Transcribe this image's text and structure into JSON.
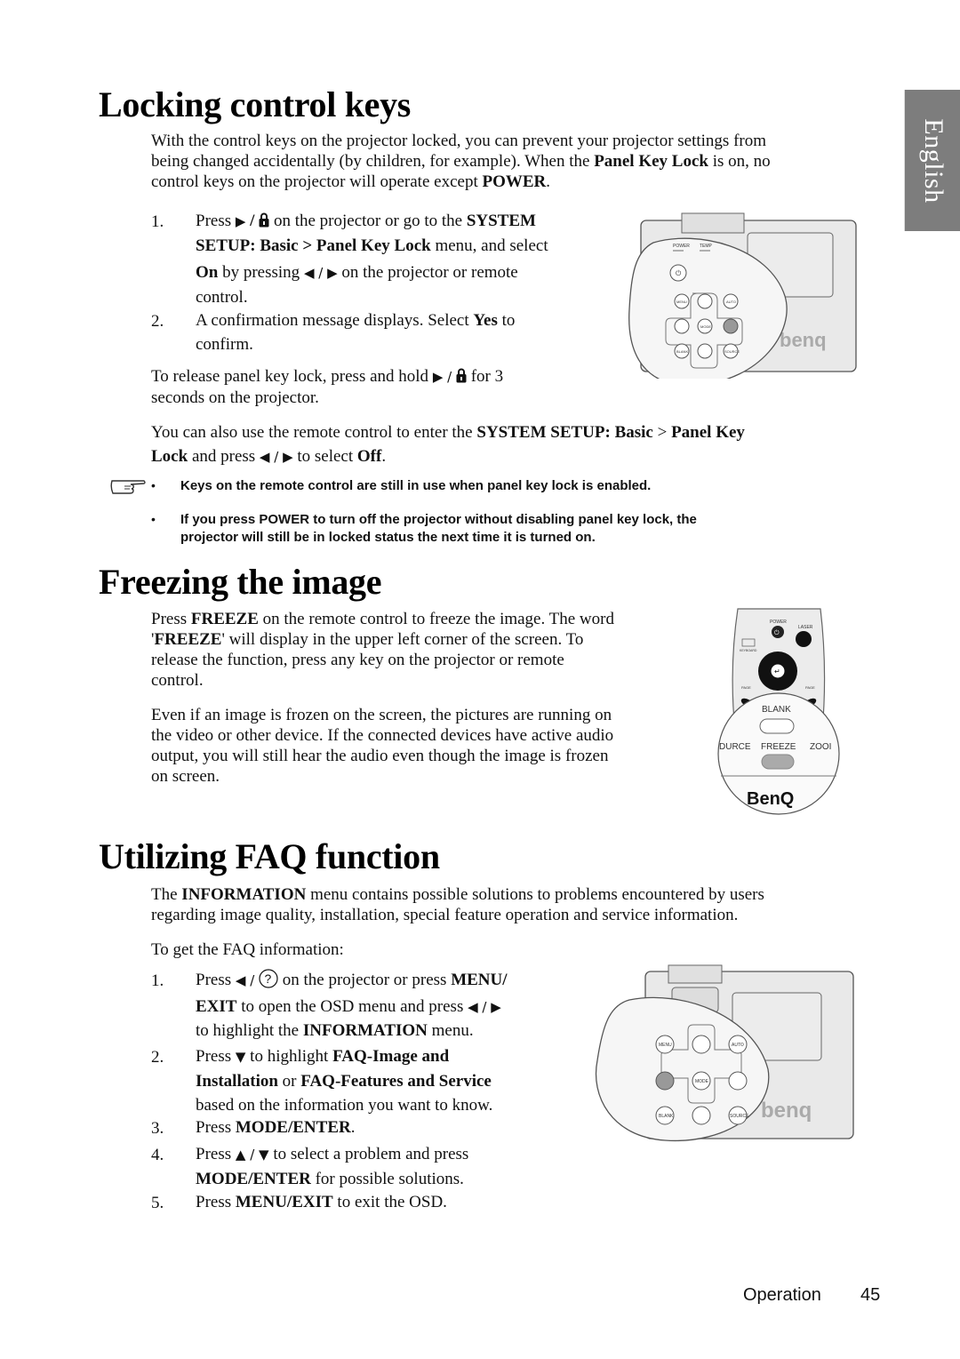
{
  "side_tab": {
    "label": "English"
  },
  "section1": {
    "title": "Locking control keys",
    "intro": {
      "t1": "With the control keys on the projector locked, you can prevent your projector settings from",
      "t2": "being changed accidentally (by children, for example). When the ",
      "b1": "Panel Key Lock",
      "t3": " is on, no",
      "t4": "control keys on the projector will operate except ",
      "b2": "POWER",
      "t5": "."
    },
    "steps": [
      {
        "num": "1.",
        "l1a": "Press ",
        "l1b": " on the projector or go to the ",
        "l1bold": "SYSTEM",
        "l2bold": "SETUP: Basic > Panel Key Lock",
        "l2b": " menu, and select",
        "l3bold": "On",
        "l3a": " by pressing ",
        "l3b": " on the projector or remote",
        "l4": "control."
      },
      {
        "num": "2.",
        "l1a": "A confirmation message displays. Select ",
        "l1bold": "Yes",
        "l1b": " to",
        "l2": "confirm."
      }
    ],
    "release": {
      "t1": "To release panel key lock, press and hold ",
      "t2": " for 3",
      "t3": "seconds on the projector."
    },
    "remote": {
      "t1": "You can also use the remote control to enter the ",
      "b1": "SYSTEM SETUP: Basic",
      "t2": " > ",
      "b2": "Panel Key",
      "b3": "Lock",
      "t3": " and press ",
      "t4": " to select ",
      "b4": "Off",
      "t5": "."
    },
    "notes": [
      "Keys on the remote control are still in use when panel key lock is enabled.",
      "If you press POWER to turn off the projector without disabling panel key lock, the",
      "projector will still be in locked status the next time it is turned on."
    ],
    "figure": {
      "labels": [
        "POWER",
        "TEMP",
        "MENU EXIT",
        "AUTO",
        "MODE ENTER",
        "BLANK",
        "SOURCE"
      ],
      "brand": "benq"
    }
  },
  "section2": {
    "title": "Freezing the image",
    "p1": {
      "t1": "Press ",
      "b1": "FREEZE",
      "t2": " on the remote control to freeze the image. The word",
      "t3": "'",
      "b2": "FREEZE",
      "t4": "' will display in the upper left corner of the screen. To",
      "t5": "release the function, press any key on the projector or remote",
      "t6": "control."
    },
    "p2": [
      "Even if an image is frozen on the screen, the pictures are running on",
      "the video or other device. If the connected devices have active audio",
      "output, you will still hear the audio even though the image is frozen",
      "on screen."
    ],
    "figure": {
      "labels": [
        "POWER",
        "LASER",
        "KEYBOARD FUNCTION",
        "PAGE UP",
        "PAGE DOWN",
        "BLANK",
        "DURCE",
        "FREEZE",
        "ZOOI"
      ],
      "brand": "BenQ"
    }
  },
  "section3": {
    "title": "Utilizing FAQ function",
    "intro": {
      "t1": "The ",
      "b1": "INFORMATION",
      "t2": " menu contains possible solutions to problems encountered by users",
      "t3": "regarding image quality, installation, special feature operation and service information."
    },
    "lead": "To get the FAQ information:",
    "steps": [
      {
        "num": "1.",
        "l1a": "Press ",
        "l1b": " on the projector or press ",
        "l1bold": "MENU/",
        "l2bold": "EXIT",
        "l2a": " to open the OSD menu and press ",
        "l3a": "to highlight the ",
        "l3bold": "INFORMATION",
        "l3b": " menu."
      },
      {
        "num": "2.",
        "l1a": "Press ",
        "l1b": " to highlight ",
        "l1bold": "FAQ-Image and",
        "l2bold1": "Installation",
        "l2a": " or ",
        "l2bold2": "FAQ-Features and Service",
        "l3": "based on the information you want to know."
      },
      {
        "num": "3.",
        "l1a": "Press ",
        "l1bold": "MODE/ENTER",
        "l1b": "."
      },
      {
        "num": "4.",
        "l1a": "Press ",
        "l1b": " to select a problem and press",
        "l2bold": "MODE/ENTER",
        "l2a": " for possible solutions."
      },
      {
        "num": "5.",
        "l1a": "Press ",
        "l1bold": "MENU/EXIT",
        "l1b": " to exit the OSD."
      }
    ],
    "figure": {
      "labels": [
        "MENU EXIT",
        "AUTO",
        "MODE ENTER",
        "BLANK",
        "SOURCE"
      ],
      "brand": "benq"
    }
  },
  "footer": {
    "section": "Operation",
    "page": "45"
  },
  "glyphs": {
    "right": "▶",
    "left": "◀",
    "up": "▲",
    "down": "▼",
    "slash": " / "
  }
}
